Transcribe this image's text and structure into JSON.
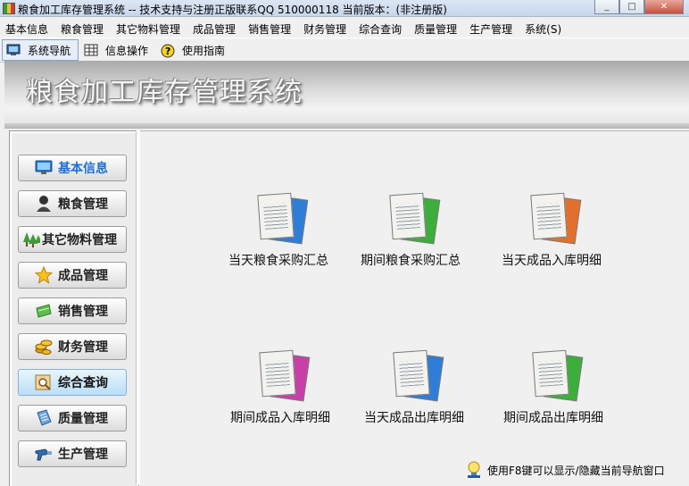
{
  "window": {
    "title": "粮食加工库存管理系统 -- 技术支持与注册正版联系QQ 510000118   当前版本：(非注册版)",
    "minimize": "_",
    "maximize": "□",
    "close": "✕"
  },
  "menu": [
    "基本信息",
    "粮食管理",
    "其它物料管理",
    "成品管理",
    "销售管理",
    "财务管理",
    "综合查询",
    "质量管理",
    "生产管理",
    "系统(S)"
  ],
  "toolbar": {
    "nav": "系统导航",
    "info": "信息操作",
    "guide": "使用指南"
  },
  "banner": {
    "title": "粮食加工库存管理系统"
  },
  "sidebar": {
    "items": [
      {
        "label": "基本信息",
        "icon": "monitor-icon",
        "color": "#1f6fd0"
      },
      {
        "label": "粮食管理",
        "icon": "person-icon",
        "color": "#222222"
      },
      {
        "label": "其它物料管理",
        "icon": "trees-icon",
        "color": "#222222"
      },
      {
        "label": "成品管理",
        "icon": "star-icon",
        "color": "#222222"
      },
      {
        "label": "销售管理",
        "icon": "leaf-icon",
        "color": "#222222"
      },
      {
        "label": "财务管理",
        "icon": "coins-icon",
        "color": "#222222"
      },
      {
        "label": "综合查询",
        "icon": "search-doc-icon",
        "color": "#222222"
      },
      {
        "label": "质量管理",
        "icon": "certificate-icon",
        "color": "#222222"
      },
      {
        "label": "生产管理",
        "icon": "tool-icon",
        "color": "#222222"
      }
    ],
    "active_index": 6
  },
  "reports": [
    {
      "label": "当天粮食采购汇总",
      "accent": "#2f7dd6"
    },
    {
      "label": "期间粮食采购汇总",
      "accent": "#3cae3c"
    },
    {
      "label": "当天成品入库明细",
      "accent": "#e2702c"
    },
    {
      "label": "期间成品入库明细",
      "accent": "#c83fa8"
    },
    {
      "label": "当天成品出库明细",
      "accent": "#2f7dd6"
    },
    {
      "label": "期间成品出库明细",
      "accent": "#3cae3c"
    }
  ],
  "hint": "使用F8键可以显示/隐藏当前导航窗口"
}
